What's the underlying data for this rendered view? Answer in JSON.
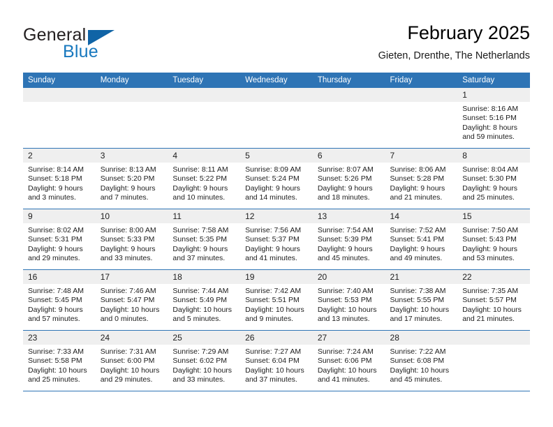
{
  "logo": {
    "word_one": "General",
    "word_two": "Blue",
    "triangle_icon": "blue-triangle-icon"
  },
  "header": {
    "title": "February 2025",
    "subtitle": "Gieten, Drenthe, The Netherlands"
  },
  "colors": {
    "header_blue": "#2E74B5",
    "logo_blue": "#1878BE",
    "daynum_band": "#EFEFEF",
    "text": "#1C1C1C"
  },
  "weekdays": [
    "Sunday",
    "Monday",
    "Tuesday",
    "Wednesday",
    "Thursday",
    "Friday",
    "Saturday"
  ],
  "labels": {
    "sunrise": "Sunrise:",
    "sunset": "Sunset:",
    "daylight": "Daylight:"
  },
  "weeks": [
    [
      {
        "day": "",
        "empty": true
      },
      {
        "day": "",
        "empty": true
      },
      {
        "day": "",
        "empty": true
      },
      {
        "day": "",
        "empty": true
      },
      {
        "day": "",
        "empty": true
      },
      {
        "day": "",
        "empty": true
      },
      {
        "day": "1",
        "sunrise": "Sunrise: 8:16 AM",
        "sunset": "Sunset: 5:16 PM",
        "daylight_1": "Daylight: 8 hours",
        "daylight_2": "and 59 minutes."
      }
    ],
    [
      {
        "day": "2",
        "sunrise": "Sunrise: 8:14 AM",
        "sunset": "Sunset: 5:18 PM",
        "daylight_1": "Daylight: 9 hours",
        "daylight_2": "and 3 minutes."
      },
      {
        "day": "3",
        "sunrise": "Sunrise: 8:13 AM",
        "sunset": "Sunset: 5:20 PM",
        "daylight_1": "Daylight: 9 hours",
        "daylight_2": "and 7 minutes."
      },
      {
        "day": "4",
        "sunrise": "Sunrise: 8:11 AM",
        "sunset": "Sunset: 5:22 PM",
        "daylight_1": "Daylight: 9 hours",
        "daylight_2": "and 10 minutes."
      },
      {
        "day": "5",
        "sunrise": "Sunrise: 8:09 AM",
        "sunset": "Sunset: 5:24 PM",
        "daylight_1": "Daylight: 9 hours",
        "daylight_2": "and 14 minutes."
      },
      {
        "day": "6",
        "sunrise": "Sunrise: 8:07 AM",
        "sunset": "Sunset: 5:26 PM",
        "daylight_1": "Daylight: 9 hours",
        "daylight_2": "and 18 minutes."
      },
      {
        "day": "7",
        "sunrise": "Sunrise: 8:06 AM",
        "sunset": "Sunset: 5:28 PM",
        "daylight_1": "Daylight: 9 hours",
        "daylight_2": "and 21 minutes."
      },
      {
        "day": "8",
        "sunrise": "Sunrise: 8:04 AM",
        "sunset": "Sunset: 5:30 PM",
        "daylight_1": "Daylight: 9 hours",
        "daylight_2": "and 25 minutes."
      }
    ],
    [
      {
        "day": "9",
        "sunrise": "Sunrise: 8:02 AM",
        "sunset": "Sunset: 5:31 PM",
        "daylight_1": "Daylight: 9 hours",
        "daylight_2": "and 29 minutes."
      },
      {
        "day": "10",
        "sunrise": "Sunrise: 8:00 AM",
        "sunset": "Sunset: 5:33 PM",
        "daylight_1": "Daylight: 9 hours",
        "daylight_2": "and 33 minutes."
      },
      {
        "day": "11",
        "sunrise": "Sunrise: 7:58 AM",
        "sunset": "Sunset: 5:35 PM",
        "daylight_1": "Daylight: 9 hours",
        "daylight_2": "and 37 minutes."
      },
      {
        "day": "12",
        "sunrise": "Sunrise: 7:56 AM",
        "sunset": "Sunset: 5:37 PM",
        "daylight_1": "Daylight: 9 hours",
        "daylight_2": "and 41 minutes."
      },
      {
        "day": "13",
        "sunrise": "Sunrise: 7:54 AM",
        "sunset": "Sunset: 5:39 PM",
        "daylight_1": "Daylight: 9 hours",
        "daylight_2": "and 45 minutes."
      },
      {
        "day": "14",
        "sunrise": "Sunrise: 7:52 AM",
        "sunset": "Sunset: 5:41 PM",
        "daylight_1": "Daylight: 9 hours",
        "daylight_2": "and 49 minutes."
      },
      {
        "day": "15",
        "sunrise": "Sunrise: 7:50 AM",
        "sunset": "Sunset: 5:43 PM",
        "daylight_1": "Daylight: 9 hours",
        "daylight_2": "and 53 minutes."
      }
    ],
    [
      {
        "day": "16",
        "sunrise": "Sunrise: 7:48 AM",
        "sunset": "Sunset: 5:45 PM",
        "daylight_1": "Daylight: 9 hours",
        "daylight_2": "and 57 minutes."
      },
      {
        "day": "17",
        "sunrise": "Sunrise: 7:46 AM",
        "sunset": "Sunset: 5:47 PM",
        "daylight_1": "Daylight: 10 hours",
        "daylight_2": "and 0 minutes."
      },
      {
        "day": "18",
        "sunrise": "Sunrise: 7:44 AM",
        "sunset": "Sunset: 5:49 PM",
        "daylight_1": "Daylight: 10 hours",
        "daylight_2": "and 5 minutes."
      },
      {
        "day": "19",
        "sunrise": "Sunrise: 7:42 AM",
        "sunset": "Sunset: 5:51 PM",
        "daylight_1": "Daylight: 10 hours",
        "daylight_2": "and 9 minutes."
      },
      {
        "day": "20",
        "sunrise": "Sunrise: 7:40 AM",
        "sunset": "Sunset: 5:53 PM",
        "daylight_1": "Daylight: 10 hours",
        "daylight_2": "and 13 minutes."
      },
      {
        "day": "21",
        "sunrise": "Sunrise: 7:38 AM",
        "sunset": "Sunset: 5:55 PM",
        "daylight_1": "Daylight: 10 hours",
        "daylight_2": "and 17 minutes."
      },
      {
        "day": "22",
        "sunrise": "Sunrise: 7:35 AM",
        "sunset": "Sunset: 5:57 PM",
        "daylight_1": "Daylight: 10 hours",
        "daylight_2": "and 21 minutes."
      }
    ],
    [
      {
        "day": "23",
        "sunrise": "Sunrise: 7:33 AM",
        "sunset": "Sunset: 5:58 PM",
        "daylight_1": "Daylight: 10 hours",
        "daylight_2": "and 25 minutes."
      },
      {
        "day": "24",
        "sunrise": "Sunrise: 7:31 AM",
        "sunset": "Sunset: 6:00 PM",
        "daylight_1": "Daylight: 10 hours",
        "daylight_2": "and 29 minutes."
      },
      {
        "day": "25",
        "sunrise": "Sunrise: 7:29 AM",
        "sunset": "Sunset: 6:02 PM",
        "daylight_1": "Daylight: 10 hours",
        "daylight_2": "and 33 minutes."
      },
      {
        "day": "26",
        "sunrise": "Sunrise: 7:27 AM",
        "sunset": "Sunset: 6:04 PM",
        "daylight_1": "Daylight: 10 hours",
        "daylight_2": "and 37 minutes."
      },
      {
        "day": "27",
        "sunrise": "Sunrise: 7:24 AM",
        "sunset": "Sunset: 6:06 PM",
        "daylight_1": "Daylight: 10 hours",
        "daylight_2": "and 41 minutes."
      },
      {
        "day": "28",
        "sunrise": "Sunrise: 7:22 AM",
        "sunset": "Sunset: 6:08 PM",
        "daylight_1": "Daylight: 10 hours",
        "daylight_2": "and 45 minutes."
      },
      {
        "day": "",
        "empty": true
      }
    ]
  ]
}
